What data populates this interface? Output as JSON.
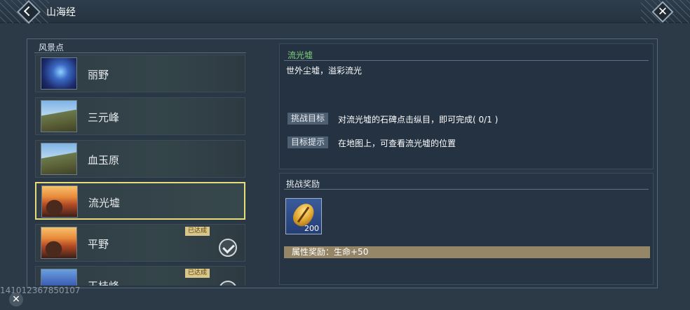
{
  "header": {
    "title": "山海经"
  },
  "list": {
    "header": "风景点",
    "items": [
      {
        "name": "丽野",
        "thumb": "t-blue",
        "completed": false,
        "selected": false
      },
      {
        "name": "三元峰",
        "thumb": "t-mtn",
        "completed": false,
        "selected": false
      },
      {
        "name": "血玉原",
        "thumb": "t-mtn",
        "completed": false,
        "selected": false
      },
      {
        "name": "流光墟",
        "thumb": "t-sunset",
        "completed": false,
        "selected": true
      },
      {
        "name": "平野",
        "thumb": "t-sunset",
        "completed": true,
        "selected": false
      },
      {
        "name": "王桂峰",
        "thumb": "t-blue2",
        "completed": true,
        "selected": false
      }
    ],
    "done_label": "已达成"
  },
  "detail": {
    "title": "流光墟",
    "description": "世外尘墟，溢彩流光",
    "challenge_tag": "挑战目标",
    "challenge_text": "对流光墟的石碑点击纵目，即可完成( 0/1 )",
    "hint_tag": "目标提示",
    "hint_text": "在地图上，可查看流光墟的位置"
  },
  "reward": {
    "header": "挑战奖励",
    "item_count": "200",
    "attr_text": "属性奖励：生命+50"
  },
  "footer": {
    "watermark": "141012367850107"
  }
}
